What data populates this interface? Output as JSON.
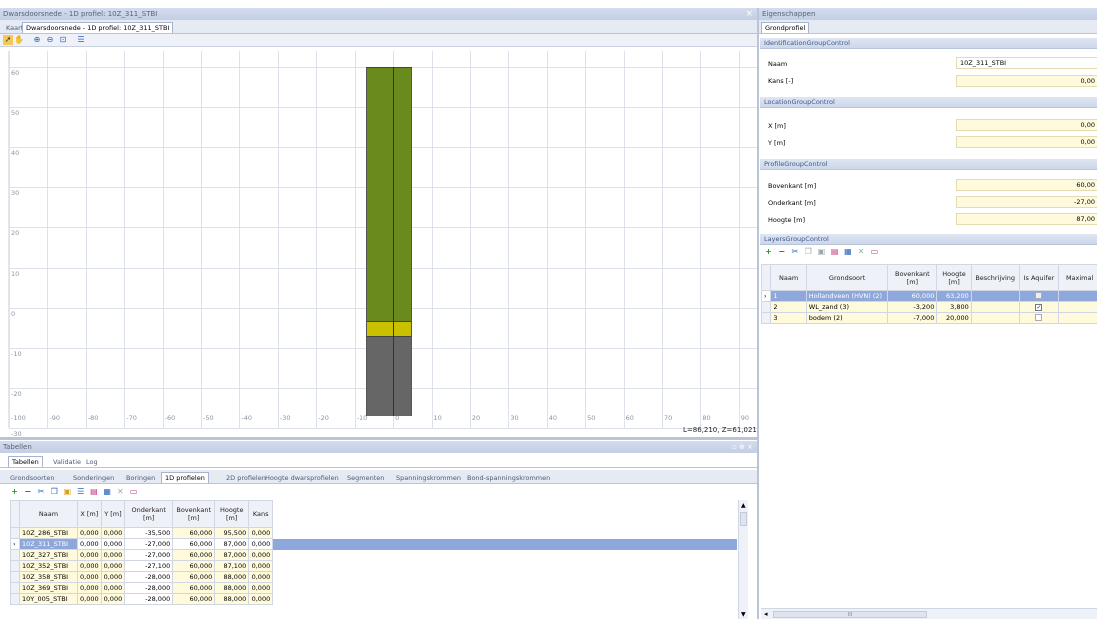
{
  "main_window": {
    "title": "Dwarsdoorsnede - 1D profiel: 10Z_311_STBI",
    "close": "×"
  },
  "main_tabs": [
    {
      "label": "Kaart"
    },
    {
      "label": "Dwarsdoorsnede - 1D profiel: 10Z_311_STBI"
    }
  ],
  "chart_data": {
    "type": "bar",
    "description_axis": "elevation",
    "yticks": [
      "60",
      "50",
      "40",
      "30",
      "20",
      "10",
      "0",
      "-10",
      "-20",
      "-30"
    ],
    "xticks": [
      "-100",
      "-90",
      "-80",
      "-70",
      "-60",
      "-50",
      "-40",
      "-30",
      "-20",
      "-10",
      "0",
      "10",
      "20",
      "30",
      "40",
      "50",
      "60",
      "70",
      "80",
      "90"
    ],
    "ylim": [
      -30,
      64
    ],
    "xlim": [
      -100,
      95
    ],
    "layers": [
      {
        "top": 60.0,
        "bottom": -3.2,
        "color": "#6b8a1e"
      },
      {
        "top": -3.2,
        "bottom": -7.0,
        "color": "#c9c000"
      },
      {
        "top": -7.0,
        "bottom": -27.0,
        "color": "#666666"
      }
    ],
    "coord_readout": "L=86,210, Z=61,021"
  },
  "properties": {
    "title": "Eigenschappen",
    "tab": "Grondprofiel",
    "groups": {
      "identification": "IdentificationGroupControl",
      "location": "LocationGroupControl",
      "profile": "ProfileGroupControl",
      "layers": "LayersGroupControl"
    },
    "naam_label": "Naam",
    "naam_value": "10Z_311_STBI",
    "kans_label": "Kans [-]",
    "kans_value": "0,00",
    "x_label": "X [m]",
    "x_value": "0,00",
    "y_label": "Y [m]",
    "y_value": "0,00",
    "bovenkant_label": "Bovenkant [m]",
    "bovenkant_value": "60,00",
    "onderkant_label": "Onderkant [m]",
    "onderkant_value": "-27,00",
    "hoogte_label": "Hoogte [m]",
    "hoogte_value": "87,00",
    "layers_headers": [
      "Naam",
      "Grondsoort",
      "Bovenkant [m]",
      "Hoogte [m]",
      "Beschrijving",
      "Is Aquifer",
      "Maximal"
    ],
    "layers_rows": [
      {
        "naam": "1",
        "grondsoort": "Hollandveen (HVN) (2)",
        "bovenkant": "60,000",
        "hoogte": "63,200",
        "aquifer": false
      },
      {
        "naam": "2",
        "grondsoort": "WL_zand (3)",
        "bovenkant": "-3,200",
        "hoogte": "3,800",
        "aquifer": true
      },
      {
        "naam": "3",
        "grondsoort": "bodem (2)",
        "bovenkant": "-7,000",
        "hoogte": "20,000",
        "aquifer": false
      }
    ],
    "scroll_label": "III"
  },
  "tables": {
    "title": "Tabellen",
    "window_buttons": "▫ ⊕ ×",
    "top_tabs": [
      {
        "label": "Tabellen"
      },
      {
        "label": "Validatie"
      },
      {
        "label": "Log"
      }
    ],
    "sub_tabs": [
      {
        "label": "Grondsoorten"
      },
      {
        "label": "Sonderingen"
      },
      {
        "label": "Boringen"
      },
      {
        "label": "1D profielen"
      },
      {
        "label": "2D profielen"
      },
      {
        "label": "Hoogte dwarsprofielen"
      },
      {
        "label": "Segmenten"
      },
      {
        "label": "Spanningskrommen"
      },
      {
        "label": "Bond-spanningskrommen"
      }
    ],
    "headers": [
      "Naam",
      "X [m]",
      "Y [m]",
      "Onderkant [m]",
      "Bovenkant [m]",
      "Hoogte [m]",
      "Kans"
    ],
    "rows": [
      [
        "10Z_286_STBI",
        "0,000",
        "0,000",
        "-35,500",
        "60,000",
        "95,500",
        "0,000"
      ],
      [
        "10Z_311_STBI",
        "0,000",
        "0,000",
        "-27,000",
        "60,000",
        "87,000",
        "0,000"
      ],
      [
        "10Z_327_STBI",
        "0,000",
        "0,000",
        "-27,000",
        "60,000",
        "87,000",
        "0,000"
      ],
      [
        "10Z_352_STBI",
        "0,000",
        "0,000",
        "-27,100",
        "60,000",
        "87,100",
        "0,000"
      ],
      [
        "10Z_358_STBI",
        "0,000",
        "0,000",
        "-28,000",
        "60,000",
        "88,000",
        "0,000"
      ],
      [
        "10Z_369_STBI",
        "0,000",
        "0,000",
        "-28,000",
        "60,000",
        "88,000",
        "0,000"
      ],
      [
        "10Y_005_STBI",
        "0,000",
        "0,000",
        "-28,000",
        "60,000",
        "88,000",
        "0,000"
      ]
    ]
  }
}
